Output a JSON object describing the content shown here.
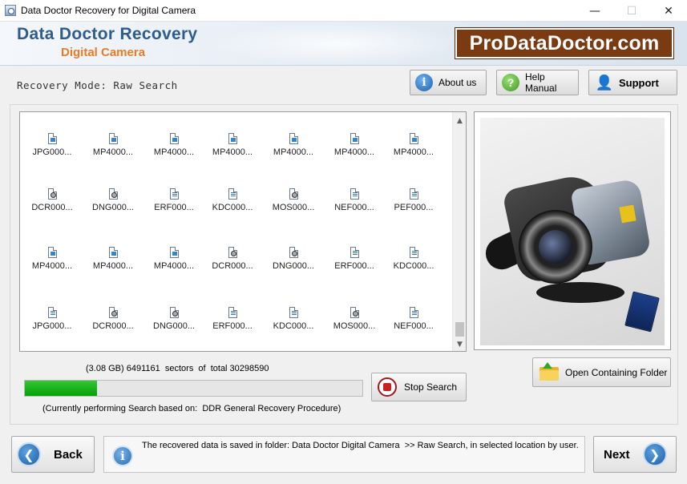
{
  "window": {
    "title": "Data Doctor Recovery for Digital Camera",
    "minimize": "—",
    "maximize": "☐",
    "close": "✕"
  },
  "header": {
    "brand_title": "Data Doctor Recovery",
    "brand_subtitle": "Digital Camera",
    "logo_text": "ProDataDoctor.com"
  },
  "toolbar": {
    "mode_label": "Recovery Mode: Raw Search",
    "about_label": "About us",
    "help_label": "Help Manual",
    "support_label": "Support"
  },
  "files": {
    "rows": [
      [
        {
          "name": "JPG000...",
          "type": "img"
        },
        {
          "name": "MP4000...",
          "type": "img"
        },
        {
          "name": "MP4000...",
          "type": "img"
        },
        {
          "name": "MP4000...",
          "type": "img"
        },
        {
          "name": "MP4000...",
          "type": "img"
        },
        {
          "name": "MP4000...",
          "type": "img"
        },
        {
          "name": "MP4000...",
          "type": "img"
        }
      ],
      [
        {
          "name": "DCR000...",
          "type": "raw"
        },
        {
          "name": "DNG000...",
          "type": "raw"
        },
        {
          "name": "ERF000...",
          "type": "doc"
        },
        {
          "name": "KDC000...",
          "type": "doc"
        },
        {
          "name": "MOS000...",
          "type": "raw"
        },
        {
          "name": "NEF000...",
          "type": "doc"
        },
        {
          "name": "PEF000...",
          "type": "doc"
        }
      ],
      [
        {
          "name": "MP4000...",
          "type": "img"
        },
        {
          "name": "MP4000...",
          "type": "img"
        },
        {
          "name": "MP4000...",
          "type": "img"
        },
        {
          "name": "DCR000...",
          "type": "raw"
        },
        {
          "name": "DNG000...",
          "type": "raw"
        },
        {
          "name": "ERF000...",
          "type": "doc"
        },
        {
          "name": "KDC000...",
          "type": "doc"
        }
      ],
      [
        {
          "name": "JPG000...",
          "type": "doc"
        },
        {
          "name": "DCR000...",
          "type": "raw"
        },
        {
          "name": "DNG000...",
          "type": "raw"
        },
        {
          "name": "ERF000...",
          "type": "doc"
        },
        {
          "name": "KDC000...",
          "type": "doc"
        },
        {
          "name": "MOS000...",
          "type": "raw"
        },
        {
          "name": "NEF000...",
          "type": "doc"
        }
      ]
    ]
  },
  "progress": {
    "sectors_text": "(3.08 GB) 6491161  sectors  of  total 30298590",
    "fraction": 0.2142,
    "status_text": "(Currently performing Search based on:  DDR General Recovery Procedure)",
    "fill_color": "#12b012"
  },
  "actions": {
    "stop_label": "Stop Search",
    "open_folder_label": "Open Containing Folder"
  },
  "footer": {
    "back_label": "Back",
    "next_label": "Next",
    "info_text": "The recovered data is saved in folder: Data Doctor Digital Camera  >> Raw Search, in selected location by user."
  },
  "icons": {
    "about": "info-icon",
    "help": "question-icon",
    "support": "user-icon",
    "stop": "stop-icon",
    "folder": "folder-icon",
    "back": "arrow-left-icon",
    "next": "arrow-right-icon",
    "info": "info-icon"
  }
}
